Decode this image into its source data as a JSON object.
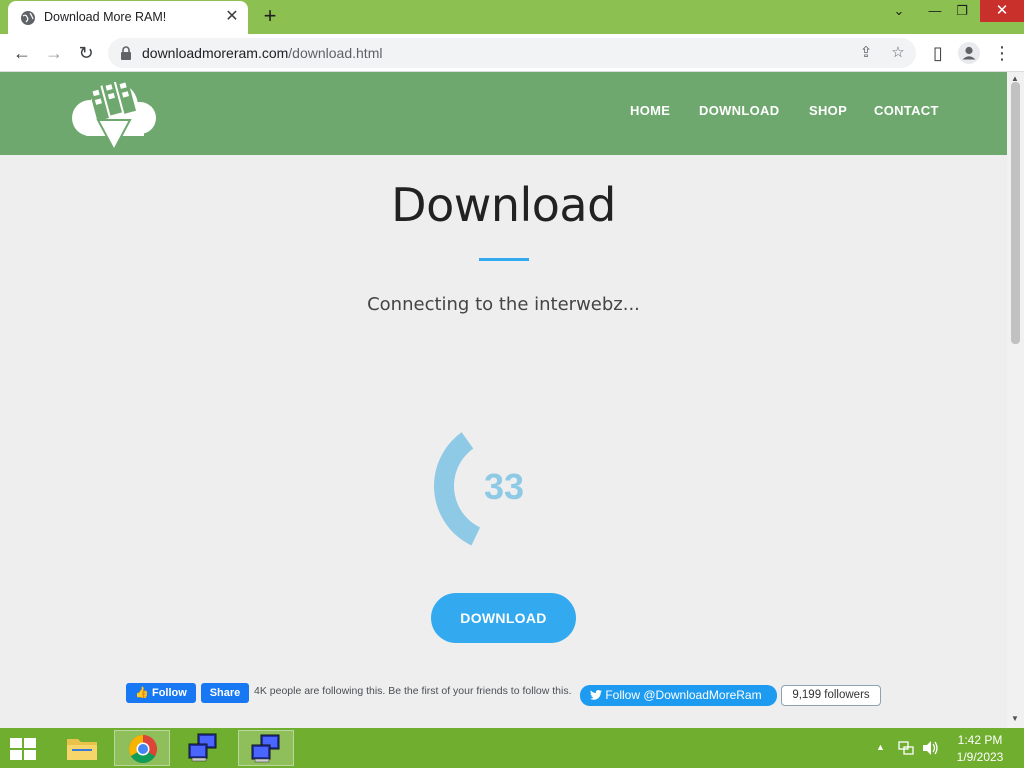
{
  "browser": {
    "tab_title": "Download More RAM!",
    "tab_close": "✕",
    "new_tab": "+",
    "url_host": "downloadmoreram.com",
    "url_path": "/download.html",
    "window_controls": {
      "dropdown": "⌄",
      "minimize": "—",
      "restore": "❐",
      "close": "✕"
    },
    "nav": {
      "back": "←",
      "forward": "→",
      "reload": "↻"
    },
    "toolbar_icons": {
      "share": "⇪",
      "bookmark": "☆",
      "sidepanel": "▯",
      "menu": "⋮"
    }
  },
  "site": {
    "nav_items": [
      "HOME",
      "DOWNLOAD",
      "SHOP",
      "CONTACT"
    ],
    "heading": "Download",
    "status": "Connecting to the interwebz...",
    "progress": {
      "value": "33",
      "percent": 33
    },
    "download_button": "DOWNLOAD",
    "facebook": {
      "follow_label": "Follow",
      "share_label": "Share",
      "text": "4K people are following this. Be the first of your friends to follow this."
    },
    "twitter": {
      "follow_label": "Follow @DownloadMoreRam",
      "followers": "9,199 followers"
    }
  },
  "taskbar": {
    "time": "1:42 PM",
    "date": "1/9/2023"
  },
  "colors": {
    "titlebar": "#8cc152",
    "site_header": "#6fa86f",
    "accent": "#33aaf0",
    "progress_ring": "#8ecae6",
    "taskbar": "#6fae2e"
  }
}
